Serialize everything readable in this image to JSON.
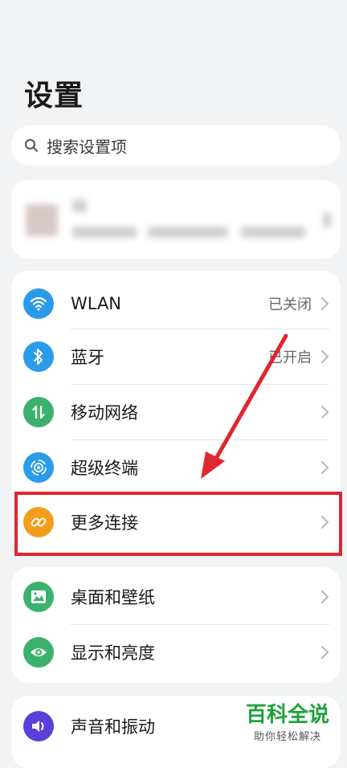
{
  "page": {
    "title": "设置"
  },
  "search": {
    "placeholder": "搜索设置项",
    "icon": "search-icon"
  },
  "groups": [
    {
      "items": [
        {
          "label": "WLAN",
          "status": "已关闭",
          "icon": "wifi-icon",
          "color": "#2a9be8"
        },
        {
          "label": "蓝牙",
          "status": "已开启",
          "icon": "bluetooth-icon",
          "color": "#2a9be8"
        },
        {
          "label": "移动网络",
          "status": "",
          "icon": "mobile-data-icon",
          "color": "#3cb16d"
        },
        {
          "label": "超级终端",
          "status": "",
          "icon": "super-device-icon",
          "color": "#2a9be8"
        },
        {
          "label": "更多连接",
          "status": "",
          "icon": "link-icon",
          "color": "#f39d1b"
        }
      ]
    },
    {
      "items": [
        {
          "label": "桌面和壁纸",
          "status": "",
          "icon": "wallpaper-icon",
          "color": "#3cb16d"
        },
        {
          "label": "显示和亮度",
          "status": "",
          "icon": "eye-icon",
          "color": "#3cb16d"
        }
      ]
    },
    {
      "items": [
        {
          "label": "声音和振动",
          "status": "",
          "icon": "sound-icon",
          "color": "#5b3fd8"
        }
      ]
    }
  ],
  "watermark": {
    "main": "百科全说",
    "sub": "助你轻松解决"
  },
  "colors": {
    "highlight": "#e0272f",
    "background": "#f1f3f5"
  }
}
